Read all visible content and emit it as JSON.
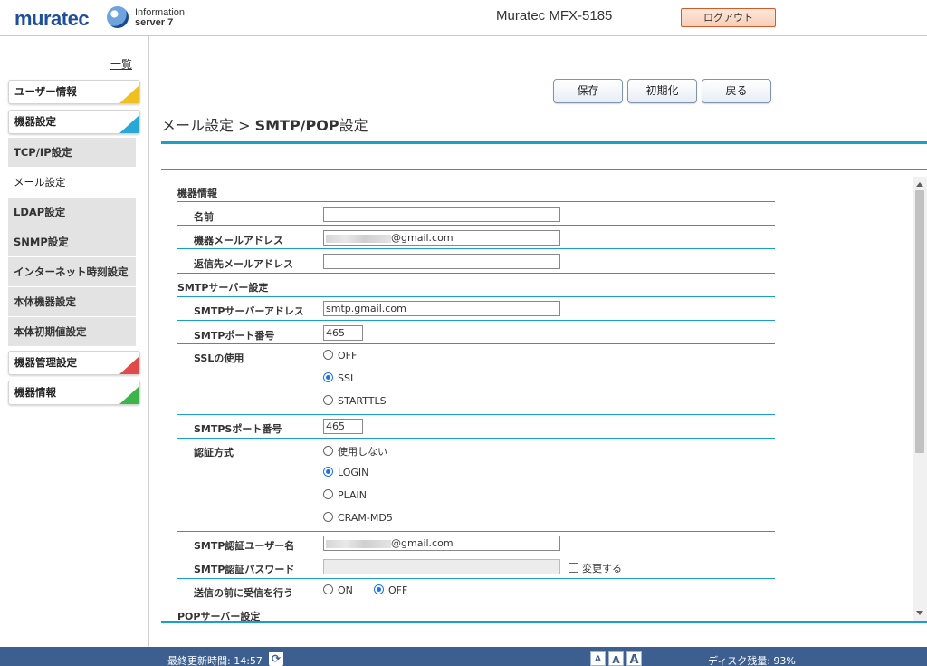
{
  "header": {
    "brand": "muratec",
    "product_line1": "Information",
    "product_line2": "server 7",
    "model": "Muratec MFX-5185",
    "logout_label": "ログアウト"
  },
  "sidebar": {
    "list_link": "一覧",
    "main_user": "ユーザー情報",
    "main_device": "機器設定",
    "sub_items": [
      "TCP/IP設定",
      "メール設定",
      "LDAP設定",
      "SNMP設定",
      "インターネット時刻設定",
      "本体機器設定",
      "本体初期値設定"
    ],
    "main_mgmt": "機器管理設定",
    "main_info": "機器情報",
    "colors": {
      "yellow": "#f0c020",
      "blue": "#29a8d8",
      "red": "#e24a4a",
      "green": "#3cb44a"
    }
  },
  "toolbar": {
    "save": "保存",
    "init": "初期化",
    "back": "戻る"
  },
  "page": {
    "title_prefix": "メール設定 > ",
    "title_main": "SMTP/POP",
    "title_suffix": "設定"
  },
  "form": {
    "sec_device": "機器情報",
    "name_label": "名前",
    "name_value": "",
    "device_mail_label": "機器メールアドレス",
    "device_mail_domain": "@gmail.com",
    "reply_label": "返信先メールアドレス",
    "reply_value": "",
    "sec_smtp": "SMTPサーバー設定",
    "smtp_addr_label": "SMTPサーバーアドレス",
    "smtp_addr_value": "smtp.gmail.com",
    "smtp_port_label": "SMTPポート番号",
    "smtp_port_value": "465",
    "ssl_label": "SSLの使用",
    "ssl_options": [
      "OFF",
      "SSL",
      "STARTTLS"
    ],
    "ssl_selected": "SSL",
    "smtps_port_label": "SMTPSポート番号",
    "smtps_port_value": "465",
    "auth_label": "認証方式",
    "auth_options": [
      "使用しない",
      "LOGIN",
      "PLAIN",
      "CRAM-MD5"
    ],
    "auth_selected": "LOGIN",
    "auth_user_label": "SMTP認証ユーザー名",
    "auth_user_domain": "@gmail.com",
    "auth_pass_label": "SMTP認証パスワード",
    "change_label": "変更する",
    "pop_before_label": "送信の前に受信を行う",
    "pop_before_options": [
      "ON",
      "OFF"
    ],
    "pop_before_selected": "OFF",
    "sec_pop": "POPサーバー設定"
  },
  "footer": {
    "last_update": "最終更新時間: 14:57",
    "font_sizes": [
      "A",
      "A",
      "A"
    ],
    "disk": "ディスク残量: 93%"
  }
}
